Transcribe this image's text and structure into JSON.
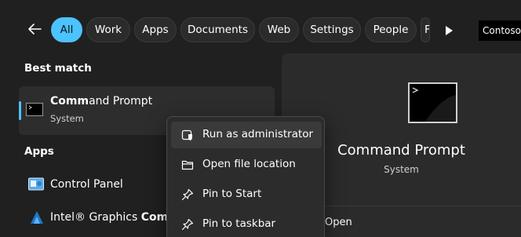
{
  "filters": {
    "back_icon": "back-arrow-icon",
    "chips": [
      {
        "label": "All",
        "active": true
      },
      {
        "label": "Work",
        "active": false
      },
      {
        "label": "Apps",
        "active": false
      },
      {
        "label": "Documents",
        "active": false
      },
      {
        "label": "Web",
        "active": false
      },
      {
        "label": "Settings",
        "active": false
      },
      {
        "label": "People",
        "active": false
      },
      {
        "label": "F",
        "active": false
      }
    ],
    "play_icon": "play-icon",
    "account": "Contoso"
  },
  "results": {
    "best_match_heading": "Best match",
    "best_match": {
      "title_bold": "Comm",
      "title_rest": "and Prompt",
      "subtitle": "System",
      "icon": "command-prompt-icon"
    },
    "apps_heading": "Apps",
    "apps": [
      {
        "label": "Control Panel",
        "icon": "control-panel-icon"
      },
      {
        "label_prefix": "Intel® Graphics ",
        "label_bold": "Comma",
        "icon": "intel-graphics-icon"
      }
    ]
  },
  "details": {
    "title": "Command Prompt",
    "subtitle": "System",
    "icon": "command-prompt-icon",
    "actions": [
      {
        "label": "Open"
      }
    ]
  },
  "context_menu": {
    "items": [
      {
        "label": "Run as administrator",
        "icon": "admin-shield-icon"
      },
      {
        "label": "Open file location",
        "icon": "folder-icon"
      },
      {
        "label": "Pin to Start",
        "icon": "pin-icon"
      },
      {
        "label": "Pin to taskbar",
        "icon": "pin-icon"
      }
    ]
  },
  "colors": {
    "background": "#202020",
    "accent": "#4cc2ff",
    "panel": "#2b2b2b",
    "menu": "#2c2c2c"
  }
}
